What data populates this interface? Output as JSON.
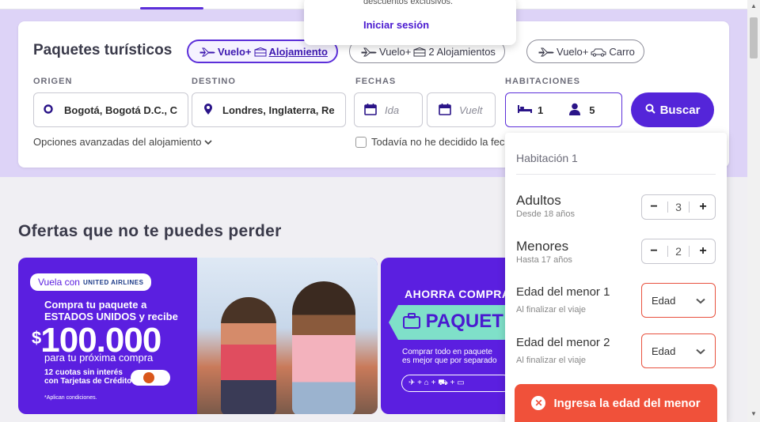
{
  "search": {
    "title": "Paquetes turísticos",
    "product_tabs": [
      {
        "label_a": "Vuelo",
        "plus": "+",
        "label_b": "Alojamiento",
        "active": true
      },
      {
        "label_a": "Vuelo",
        "plus": "+",
        "label_b": "2 Alojamientos",
        "active": false
      },
      {
        "label_a": "Vuelo",
        "plus": "+",
        "label_b": "Carro",
        "active": false
      }
    ],
    "labels": {
      "origin": "ORIGEN",
      "destination": "DESTINO",
      "dates": "FECHAS",
      "rooms": "HABITACIONES"
    },
    "origin_value": "Bogotá, Bogotá D.C., C",
    "destination_value": "Londres, Inglaterra, Re",
    "departure_placeholder": "Ida",
    "return_placeholder": "Vuelt",
    "rooms_count": "1",
    "guests_count": "5",
    "search_button": "Buscar",
    "advanced_options": "Opciones avanzadas del alojamiento",
    "undecided_dates": "Todavía no he decidido la fec"
  },
  "tooltip": {
    "text": "descuentos exclusivos.",
    "link": "Iniciar sesión"
  },
  "rooms_panel": {
    "heading": "Habitación 1",
    "adults": {
      "label": "Adultos",
      "sub": "Desde 18 años",
      "value": "3"
    },
    "minors": {
      "label": "Menores",
      "sub": "Hasta 17 años",
      "value": "2"
    },
    "minor_ages": [
      {
        "label": "Edad del menor 1",
        "sub": "Al finalizar el viaje",
        "select": "Edad"
      },
      {
        "label": "Edad del menor 2",
        "sub": "Al finalizar el viaje",
        "select": "Edad"
      }
    ],
    "error_button": "Ingresa la edad del menor"
  },
  "offers": {
    "title": "Ofertas que no te puedes perder",
    "banner1": {
      "tag": "Vuela con",
      "airline": "UNITED AIRLINES",
      "line1": "Compra tu paquete a",
      "line2": "ESTADOS UNIDOS y recibe",
      "currency": "$",
      "amount": "100.000",
      "line3": "para tu próxima compra",
      "line4a": "12 cuotas sin interés",
      "line4b": "con Tarjetas de Crédito",
      "fine_print": "*Aplican condiciones."
    },
    "banner2": {
      "line1": "AHORRA COMPRA",
      "headline": "PAQUET",
      "text1": "Comprar todo en paquete",
      "text2": "es mejor que por separado"
    }
  },
  "colors": {
    "brand": "#5425d9",
    "accent": "#5c2fd9",
    "error": "#f0513a",
    "hero_bg": "#ddd3f7"
  }
}
